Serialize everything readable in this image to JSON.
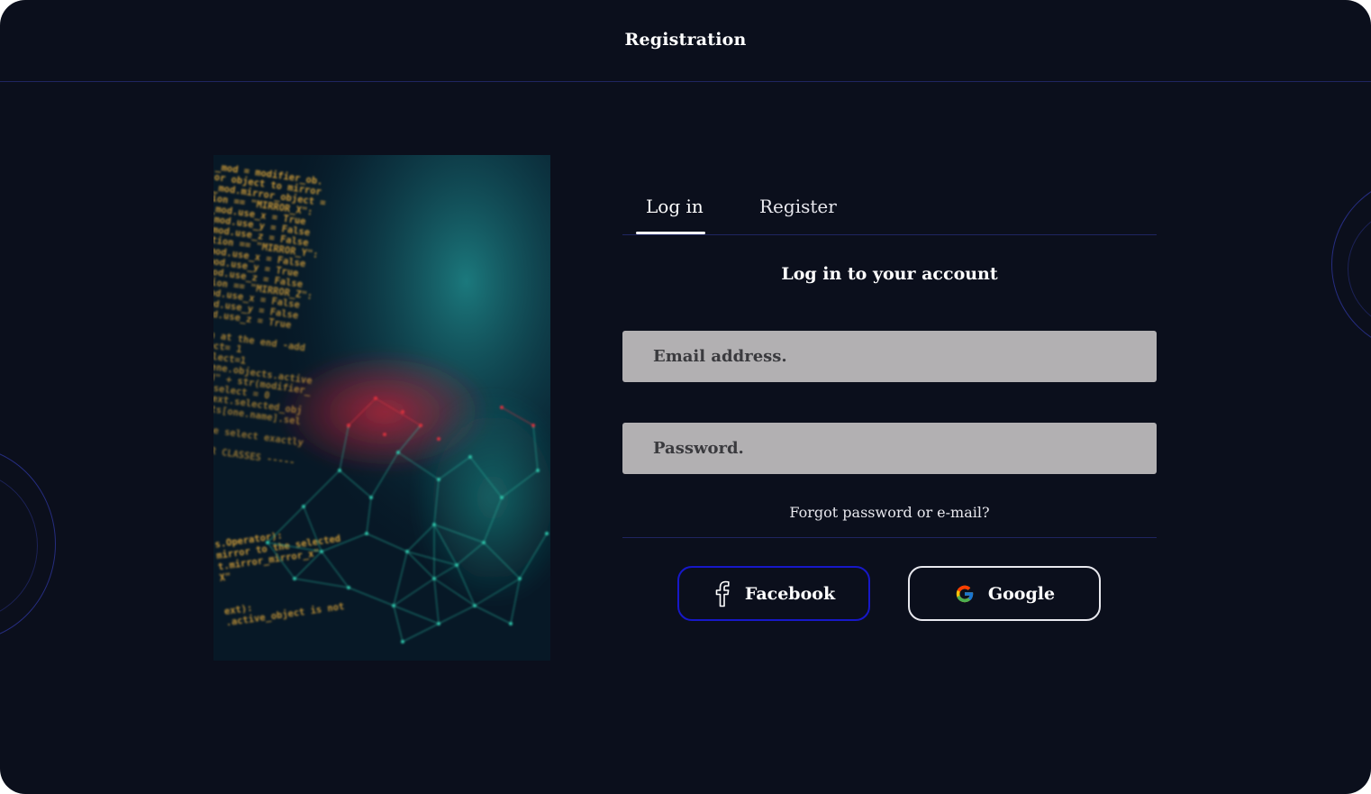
{
  "header": {
    "title": "Registration"
  },
  "tabs": [
    {
      "label": "Log in",
      "active": true
    },
    {
      "label": "Register",
      "active": false
    }
  ],
  "form": {
    "heading": "Log in to your account",
    "email": {
      "placeholder": "Email address.",
      "value": ""
    },
    "password": {
      "placeholder": "Password.",
      "value": ""
    },
    "forgot_link": "Forgot password or e-mail?"
  },
  "social": {
    "facebook": {
      "label": "Facebook",
      "icon": "facebook-icon",
      "border_color": "#1718c8"
    },
    "google": {
      "label": "Google",
      "icon": "google-icon",
      "border_color": "#e8e8ee"
    }
  },
  "hero": {
    "icon": "code-network-image",
    "code_lines": [
      "_mod = modifier_ob.",
      "or object to mirror",
      "_mod.mirror_object =",
      "ion == \"MIRROR_X\":",
      "_mod.use_x = True",
      "_mod.use_y = False",
      "_mod.use_z = False",
      "ation == \"MIRROR_Y\":",
      "_mod.use_x = False",
      "_mod.use_y = True",
      "_mod.use_z = False",
      "ation == \"MIRROR_Z\":",
      "_mod.use_x = False",
      "_mod.use_y = False",
      "_mod.use_z = True",
      "",
      "tion at the end -add",
      "select= 1",
      "b.select=1",
      "t.scene.objects.active",
      "ected\" + str(modifier_",
      "r_ob.select = 0",
      ".context.selected_obj",
      "objects[one.name].sel",
      "",
      "\"please select exactly",
      "",
      "PERATOR CLASSES -----"
    ],
    "code_lines_bottom": [
      "s.Operator):",
      "mirror to the selected",
      "t.mirror_mirror_x\"",
      " X\"",
      "",
      "",
      "ext):",
      ".active_object is not"
    ]
  },
  "colors": {
    "background": "#0b0f1c",
    "divider": "#1f2560",
    "field_bg": "#b2b0b2",
    "accent_blue": "#1718c8",
    "code_amber": "#d8a23a",
    "network_teal": "#2fc2a8",
    "network_red": "#d8303e"
  }
}
